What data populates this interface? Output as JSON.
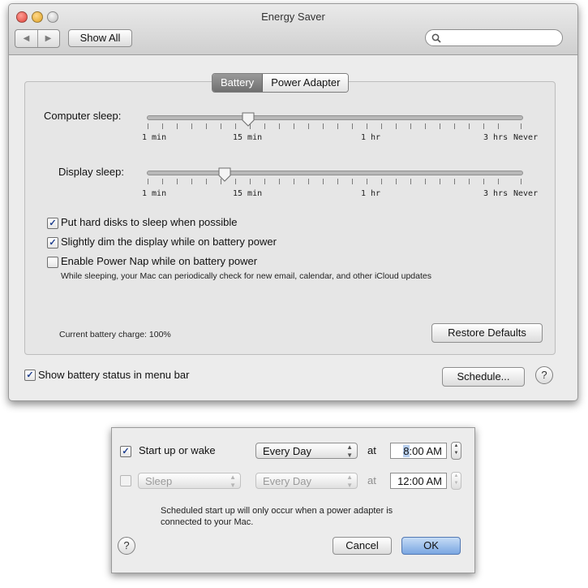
{
  "window": {
    "title": "Energy Saver",
    "show_all": "Show All",
    "search_placeholder": ""
  },
  "tabs": [
    {
      "label": "Battery",
      "selected": true
    },
    {
      "label": "Power Adapter",
      "selected": false
    }
  ],
  "sliders": {
    "computer_sleep": {
      "label": "Computer sleep:",
      "value": "15 min"
    },
    "display_sleep": {
      "label": "Display sleep:",
      "value": "10 min"
    },
    "tick_labels": [
      "1 min",
      "15 min",
      "1 hr",
      "3 hrs",
      "Never"
    ]
  },
  "options": {
    "hard_disks": {
      "label": "Put hard disks to sleep when possible",
      "checked": true
    },
    "dim_display": {
      "label": "Slightly dim the display while on battery power",
      "checked": true
    },
    "power_nap": {
      "label": "Enable Power Nap while on battery power",
      "checked": false
    },
    "power_nap_note": "While sleeping, your Mac can periodically check for new email, calendar, and other iCloud updates"
  },
  "battery_charge": "Current battery charge: 100%",
  "buttons": {
    "restore_defaults": "Restore Defaults",
    "schedule": "Schedule...",
    "help": "?"
  },
  "show_battery_status": {
    "label": "Show battery status in menu bar",
    "checked": true
  },
  "schedule_dialog": {
    "row1": {
      "checked": true,
      "label": "Start up or wake",
      "frequency": "Every Day",
      "at": "at",
      "time": "8:00 AM",
      "time_highlight": "8"
    },
    "row2": {
      "checked": false,
      "action": "Sleep",
      "frequency": "Every Day",
      "at": "at",
      "time": "12:00 AM"
    },
    "note_line1": "Scheduled start up will only occur when a power adapter is",
    "note_line2": "connected to your Mac.",
    "cancel": "Cancel",
    "ok": "OK",
    "help": "?"
  },
  "colors": {
    "checkmark": "#1c3d8e",
    "ok_button": "#8fb5ea",
    "selected_tab": "#7f7f7f"
  }
}
